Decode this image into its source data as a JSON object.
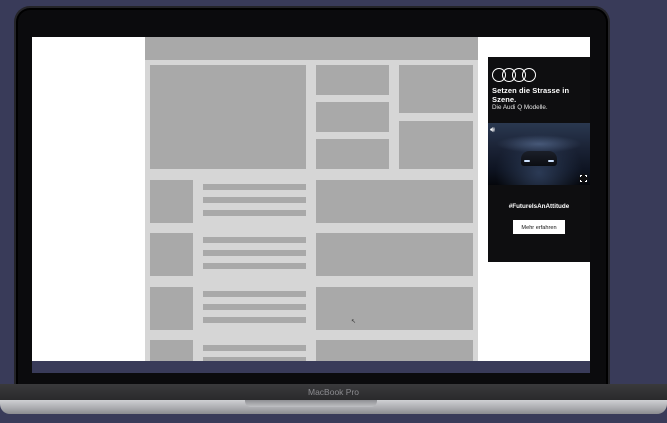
{
  "device": {
    "model_label": "MacBook Pro"
  },
  "webpage": {
    "placeholder_content": true
  },
  "ad": {
    "brand": "Audi",
    "headline": "Setzen die Strasse in Szene.",
    "subline": "Die Audi Q Modelle.",
    "hashtag": "#FutureIsAnAttitude",
    "cta_label": "Mehr erfahren",
    "icons": {
      "sound": "speaker-icon",
      "fullscreen": "fullscreen-icon"
    }
  },
  "colors": {
    "background": "#393b59",
    "placeholder": "#a9a9a9",
    "page_bg": "#d6d6d6",
    "ad_bg": "#0e0e10"
  }
}
